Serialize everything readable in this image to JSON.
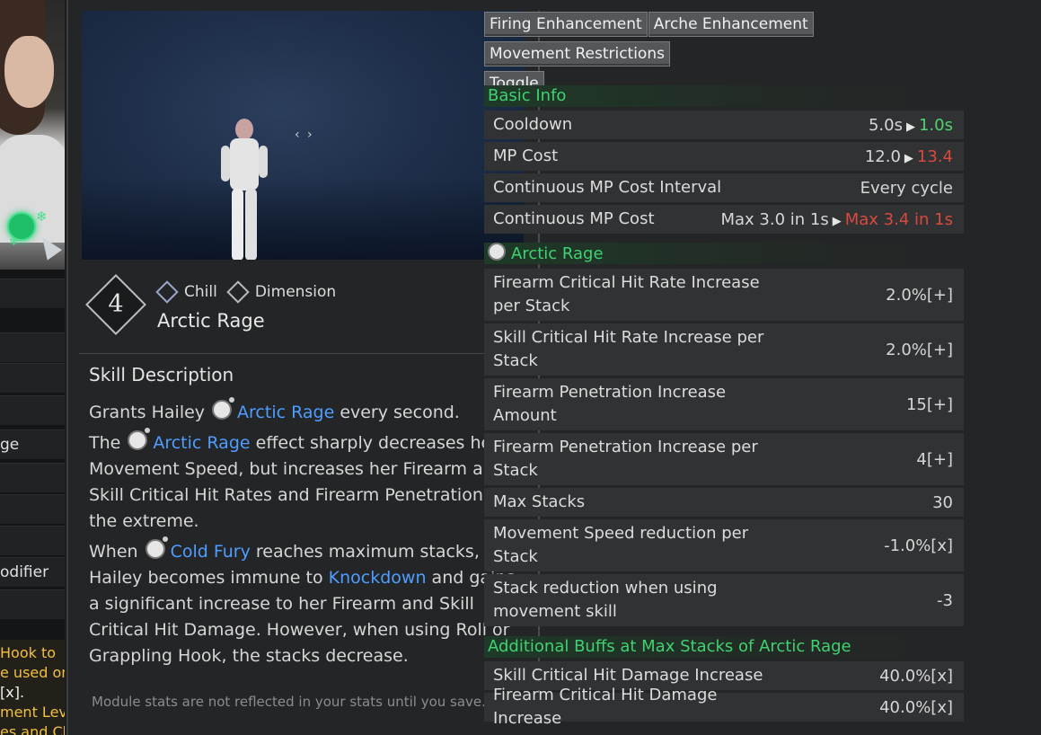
{
  "left_strip": {
    "rows": [
      "ge",
      "odifier"
    ],
    "tip_lines": [
      "Hook to",
      "e used on",
      "[x].",
      "ment Lev",
      "es and Ch"
    ]
  },
  "skill": {
    "level": "4",
    "tags": [
      "Chill",
      "Dimension"
    ],
    "name": "Arctic Rage"
  },
  "description": {
    "title": "Skill Description",
    "p1": {
      "pre": "Grants Hailey",
      "kw": "Arctic Rage",
      "post": "every second."
    },
    "p2": {
      "pre": "The",
      "kw": "Arctic Rage",
      "post": "effect sharply decreases her Movement Speed, but increases her Firearm and Skill Critical Hit Rates and Firearm Penetration to the extreme."
    },
    "p3": {
      "pre": "When",
      "kw": "Cold Fury",
      "mid": "reaches maximum stacks, Hailey becomes immune to",
      "kw2": "Knockdown",
      "post": "and gains a significant increase to her Firearm and Skill Critical Hit Damage. However, when using Roll or Grappling Hook, the stacks decrease."
    },
    "footer": "Module stats are not reflected in your stats until you save."
  },
  "tabs": [
    "Firing Enhancement",
    "Arche Enhancement",
    "Movement Restrictions",
    "Toggle"
  ],
  "basic_info": {
    "title": "Basic Info",
    "rows": [
      {
        "label": "Cooldown",
        "from": "5.0s",
        "to": "1.0s",
        "to_color": "#4fd36f"
      },
      {
        "label": "MP Cost",
        "from": "12.0",
        "to": "13.4",
        "to_color": "#d94a3e"
      },
      {
        "label": "Continuous MP Cost Interval",
        "value": "Every cycle"
      },
      {
        "label": "Continuous MP Cost",
        "from": "Max 3.0 in 1s",
        "to": "Max 3.4 in 1s",
        "to_color": "#d94a3e"
      }
    ]
  },
  "arctic_rage": {
    "title": "Arctic Rage",
    "rows": [
      {
        "label": "Firearm Critical Hit Rate Increase per Stack",
        "value": "2.0%[+]"
      },
      {
        "label": "Skill Critical Hit Rate Increase per Stack",
        "value": "2.0%[+]"
      },
      {
        "label": "Firearm Penetration Increase Amount",
        "value": "15[+]"
      },
      {
        "label": "Firearm Penetration Increase per Stack",
        "value": "4[+]"
      },
      {
        "label": "Max Stacks",
        "value": "30"
      },
      {
        "label": "Movement Speed reduction per Stack",
        "value": "-1.0%[x]"
      },
      {
        "label": "Stack reduction when using movement skill",
        "value": "-3"
      }
    ]
  },
  "additional_buffs": {
    "title": "Additional Buffs at Max Stacks of Arctic Rage",
    "rows": [
      {
        "label": "Skill Critical Hit Damage Increase",
        "value": "40.0%[x]"
      },
      {
        "label": "Firearm Critical Hit Damage Increase",
        "value": "40.0%[x]"
      }
    ]
  }
}
